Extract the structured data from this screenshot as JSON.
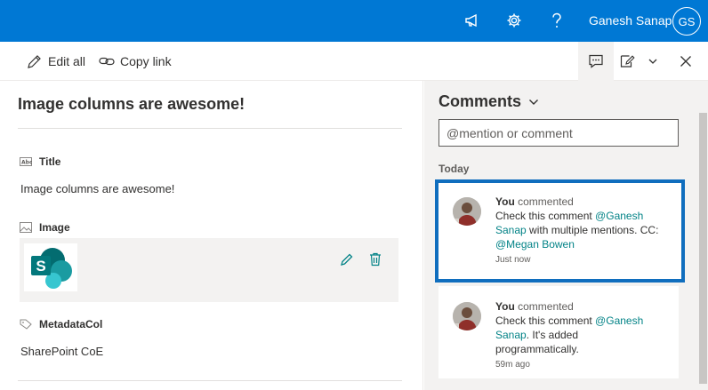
{
  "suitebar": {
    "icons": [
      "megaphone-icon",
      "gear-icon",
      "help-icon"
    ],
    "user_name": "Ganesh Sanap",
    "user_initials": "GS",
    "accent": "#0078d4"
  },
  "commandbar": {
    "edit_all_label": "Edit all",
    "copy_link_label": "Copy link",
    "right_icons": [
      "comment-icon",
      "edit-form-icon",
      "chevron-down-icon",
      "close-icon"
    ]
  },
  "form": {
    "title": "Image columns are awesome!",
    "fields": [
      {
        "label": "Title",
        "value": "Image columns are awesome!"
      },
      {
        "label": "Image",
        "value": ""
      },
      {
        "label": "MetadataCol",
        "value": "SharePoint CoE"
      }
    ]
  },
  "comments": {
    "title": "Comments",
    "input_placeholder": "@mention or comment",
    "group_label": "Today",
    "items": [
      {
        "author": "You",
        "action": "commented",
        "text_before": "Check this comment ",
        "mention1": "@Ganesh Sanap",
        "text_middle": " with multiple mentions. CC: ",
        "mention2": "@Megan Bowen",
        "time": "Just now"
      },
      {
        "author": "You",
        "action": "commented",
        "text_before": "Check this comment ",
        "mention1": "@Ganesh Sanap",
        "text_after": ". It's added programmatically.",
        "time": "59m ago"
      }
    ]
  }
}
